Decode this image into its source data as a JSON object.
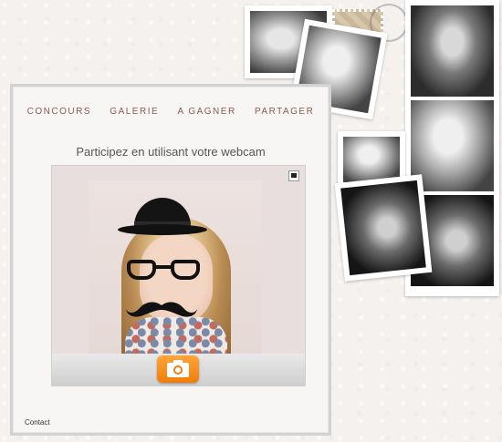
{
  "nav": {
    "items": [
      "CONCOURS",
      "GALERIE",
      "A GAGNER",
      "PARTAGER"
    ]
  },
  "headline": "Participez en utilisant votre webcam",
  "footer": {
    "contact": "Contact"
  },
  "colors": {
    "nav_text": "#8b5a52",
    "snap_button": "#f07c0b",
    "panel_border": "#d2d2d2"
  },
  "icons": {
    "snapshot": "camera-icon",
    "webcam_toggle": "webcam-toggle-icon"
  }
}
